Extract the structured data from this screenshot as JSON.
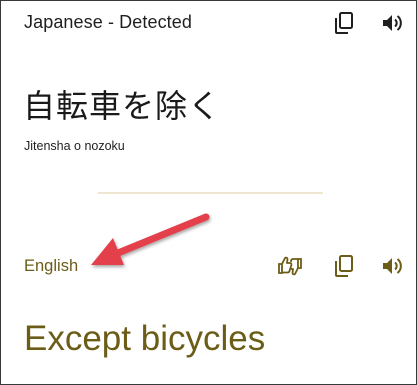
{
  "source": {
    "language_label": "Japanese - Detected",
    "text": "自転車を除く",
    "romanization": "Jitensha o nozoku",
    "copy_icon": "copy-icon",
    "speaker_icon": "speaker-icon"
  },
  "target": {
    "language_label": "English",
    "text": "Except bicycles",
    "feedback_icon": "feedback-icon",
    "copy_icon": "copy-icon",
    "speaker_icon": "speaker-icon"
  },
  "colors": {
    "text_dark": "#1f1f1f",
    "accent": "#6b5d17",
    "divider": "#efe6d1",
    "annotation_arrow": "#e4414b"
  }
}
